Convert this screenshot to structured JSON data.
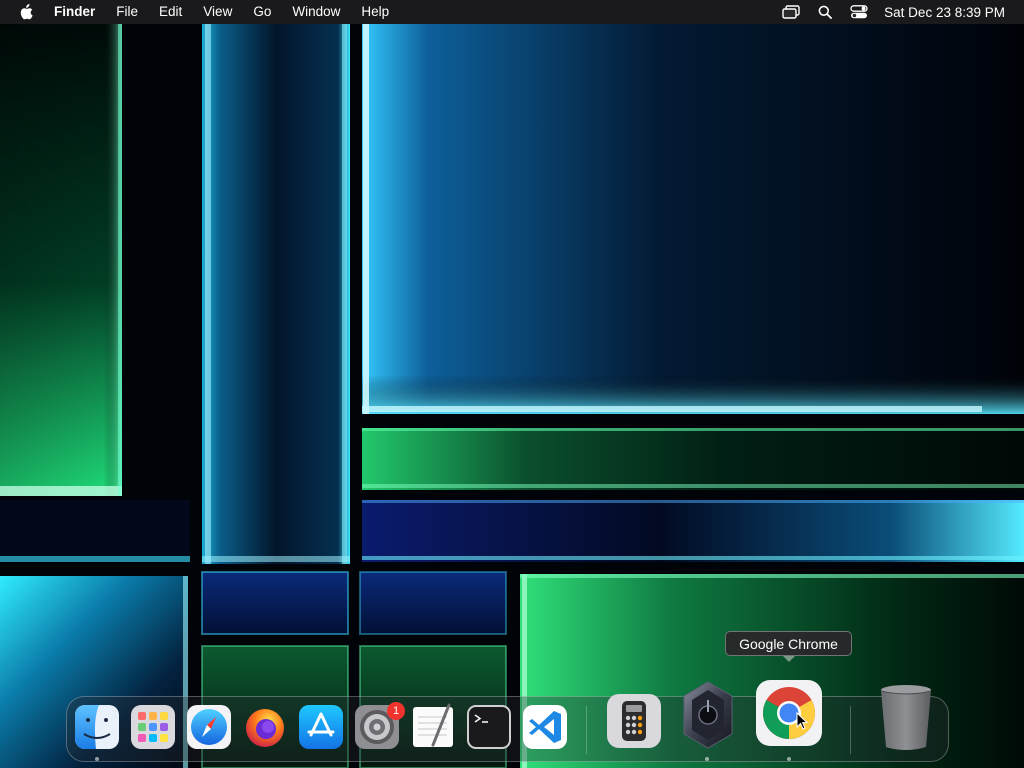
{
  "menubar": {
    "app_name": "Finder",
    "menus": [
      "File",
      "Edit",
      "View",
      "Go",
      "Window",
      "Help"
    ],
    "clock": "Sat Dec 23  8:39 PM",
    "status_icons": [
      "screen-mirroring-icon",
      "spotlight-search-icon",
      "control-center-icon"
    ]
  },
  "tooltip": {
    "label": "Google Chrome"
  },
  "dock": {
    "apps": [
      {
        "name": "Finder",
        "icon": "finder-icon",
        "running": true
      },
      {
        "name": "Launchpad",
        "icon": "launchpad-icon",
        "running": false
      },
      {
        "name": "Safari",
        "icon": "safari-icon",
        "running": false
      },
      {
        "name": "Firefox",
        "icon": "firefox-icon",
        "running": false
      },
      {
        "name": "App Store",
        "icon": "app-store-icon",
        "running": false
      },
      {
        "name": "System Preferences",
        "icon": "system-preferences-icon",
        "running": false,
        "badge": "1"
      },
      {
        "name": "TextEdit",
        "icon": "textedit-icon",
        "running": false
      },
      {
        "name": "Terminal",
        "icon": "terminal-icon",
        "running": false
      },
      {
        "name": "Visual Studio Code",
        "icon": "vscode-icon",
        "running": false
      },
      {
        "name": "Calculator",
        "icon": "calculator-icon",
        "running": false
      },
      {
        "name": "Hexagon App",
        "icon": "hexagon-app-icon",
        "running": true
      },
      {
        "name": "Google Chrome",
        "icon": "chrome-icon",
        "running": true
      },
      {
        "name": "Trash",
        "icon": "trash-icon",
        "running": false
      }
    ],
    "badge_color": "#f0332c"
  },
  "colors": {
    "menubar_bg": "#1c1c1e",
    "wallpaper_cyan": "#29e0ff",
    "wallpaper_green": "#2bd873",
    "wallpaper_blue": "#1a4cff"
  }
}
